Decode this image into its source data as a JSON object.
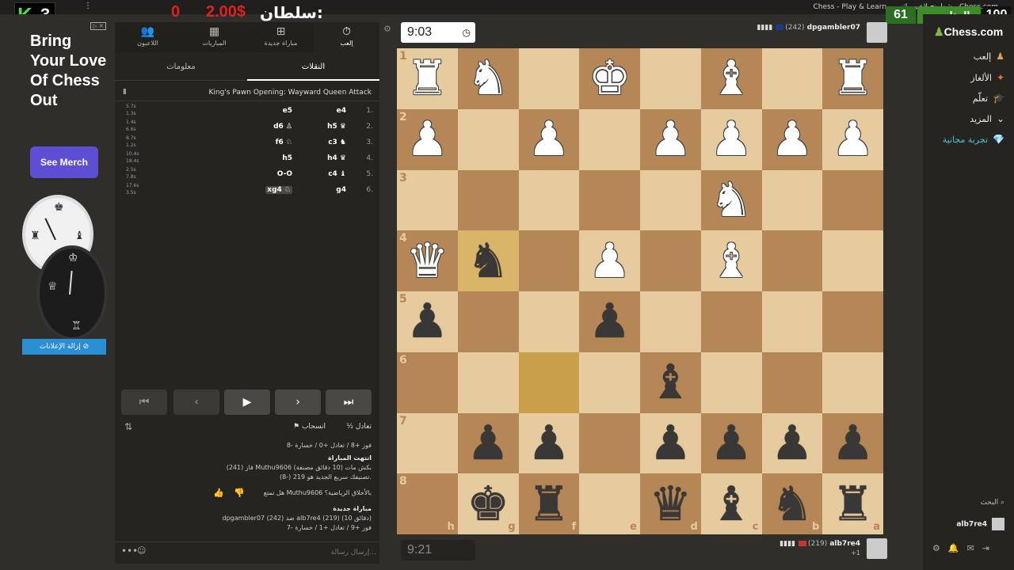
{
  "window": {
    "title": "Chess - Play & Learn - شطرنج لاعبين اثنين - Chess.com",
    "menu": "⋮"
  },
  "overlay": {
    "k3_letter": "K",
    "k3_number": "3",
    "sultan_label": "سلطان:",
    "sultan_amount": "2.00$",
    "sultan_zero": "0",
    "followers_label": "المتابعين",
    "followers_current": "61",
    "followers_goal": "100"
  },
  "ad": {
    "headline": "Bring Your Love Of Chess Out",
    "merch_button": "See Merch",
    "remove_ads": "إزالة الإعلانات"
  },
  "panel": {
    "tabs": [
      {
        "label": "إلعب",
        "icon": "⏱"
      },
      {
        "label": "مباراة جديدة",
        "icon": "⊞"
      },
      {
        "label": "المباريات",
        "icon": "▦"
      },
      {
        "label": "اللاعبون",
        "icon": "👥"
      }
    ],
    "subtabs": {
      "moves": "النقلات",
      "info": "معلومات"
    },
    "opening": "King's Pawn Opening: Wayward Queen Attack",
    "moves": [
      {
        "num": "1.",
        "white": "e4",
        "black": "e5",
        "t1": "5.7s",
        "t2": "1.3s"
      },
      {
        "num": "2.",
        "white": "h5 ♛",
        "black": "d6 ♙",
        "t1": "1.4s",
        "t2": "6.6s"
      },
      {
        "num": "3.",
        "white": "c3 ♞",
        "black": "f6 ♘",
        "t1": "8.7s",
        "t2": "1.2s"
      },
      {
        "num": "4.",
        "white": "h4 ♛",
        "black": "h5",
        "t1": "10.4s",
        "t2": "18.4s"
      },
      {
        "num": "5.",
        "white": "c4 ♝",
        "black": "O-O",
        "t1": "2.5s",
        "t2": "7.8s"
      },
      {
        "num": "6.",
        "white": "g4",
        "black": "xg4 ♘",
        "t1": "17.6s",
        "t2": "3.5s"
      }
    ],
    "nav": {
      "first": "⏮",
      "prev": "‹",
      "play": "▶",
      "next": "›",
      "last": "⏭"
    },
    "actions": {
      "draw": "½ تعادل",
      "resign": "⚑ انسحاب",
      "flip": "⇅"
    },
    "log": {
      "record1": "فوز +8 / تعادل +0 / خسارة -8",
      "game_over_title": "انتهت المباراة",
      "game_over_line": "فاز (241) Muthu9606 بكش مات (10 دقائق مصنفة)",
      "rating_line": "تصنيفك سريع الجديد هو 219 (-8).",
      "sportsmanship": "هل تمتع Muthu9606 بالأخلاق الرياضية؟",
      "new_game_title": "مباراة جديدة",
      "new_game_line": "dpgambler07 (242) ضد alb7re4 (219) (10 دقائق)",
      "record2": "فوز +9 / تعادل +1 / خسارة -7",
      "like": "👍",
      "dislike": "👎"
    },
    "chat_placeholder": "إرسال رسالة...",
    "chat_more": "•••",
    "chat_emoji": "☺"
  },
  "board": {
    "top_clock": "9:03",
    "bottom_clock": "9:21",
    "top_player": {
      "name": "dpgambler07",
      "rating": "(242)"
    },
    "bottom_player": {
      "name": "alb7re4",
      "rating": "(219)",
      "sub": "+1"
    },
    "ranks": [
      "1",
      "2",
      "3",
      "4",
      "5",
      "6",
      "7",
      "8"
    ],
    "files_shown": [
      "h",
      "g",
      "f",
      "e",
      "d",
      "c",
      "b",
      "a"
    ]
  },
  "nav": {
    "logo_pawn": "♟",
    "logo_text": "Chess.com",
    "items": [
      {
        "label": "إلعب",
        "icon": "♟"
      },
      {
        "label": "الألغاز",
        "icon": "✦"
      },
      {
        "label": "تعلّم",
        "icon": "🎓"
      },
      {
        "label": "المزيد",
        "icon": "⌄"
      },
      {
        "label": "تجربة مجانية",
        "icon": "💎"
      }
    ],
    "search": "البحث",
    "username": "alb7re4"
  }
}
